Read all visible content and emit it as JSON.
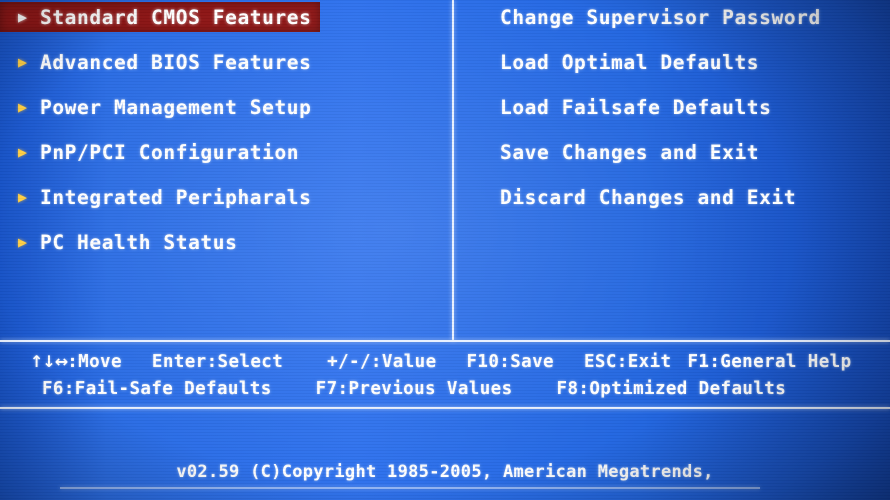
{
  "screen": {
    "background_color": "#2266dd",
    "text_color": "#ffffff",
    "highlight_color": "#8e1616",
    "arrow_color": "#ffcf45",
    "divider_color": "#e8f0ff"
  },
  "menu": {
    "left_column": [
      {
        "label": "Standard CMOS Features",
        "arrow": "▶",
        "selected": true
      },
      {
        "label": "Advanced BIOS Features",
        "arrow": "▶",
        "selected": false
      },
      {
        "label": "Power Management Setup",
        "arrow": "▶",
        "selected": false
      },
      {
        "label": "PnP/PCI Configuration",
        "arrow": "▶",
        "selected": false
      },
      {
        "label": "Integrated Peripharals",
        "arrow": "▶",
        "selected": false
      },
      {
        "label": "PC Health Status",
        "arrow": "▶",
        "selected": false
      }
    ],
    "right_column": [
      {
        "label": "Change Supervisor Password",
        "selected": false
      },
      {
        "label": "Load Optimal Defaults",
        "selected": false
      },
      {
        "label": "Load Failsafe Defaults",
        "selected": false
      },
      {
        "label": "Save Changes and Exit",
        "selected": false
      },
      {
        "label": "Discard Changes and Exit",
        "selected": false
      }
    ]
  },
  "help_bar": {
    "line1": {
      "move_keys": "↑↓↔",
      "move_label": ":Move",
      "select": "Enter:Select",
      "value": "+/-/:Value",
      "save": "F10:Save",
      "exit": "ESC:Exit",
      "general_help": "F1:General Help"
    },
    "line2": {
      "fail_safe": "F6:Fail-Safe Defaults",
      "previous_values": "F7:Previous Values",
      "optimized_defaults": "F8:Optimized Defaults"
    }
  },
  "footer": {
    "copyright": "v02.59 (C)Copyright 1985-2005, American Megatrends,"
  }
}
